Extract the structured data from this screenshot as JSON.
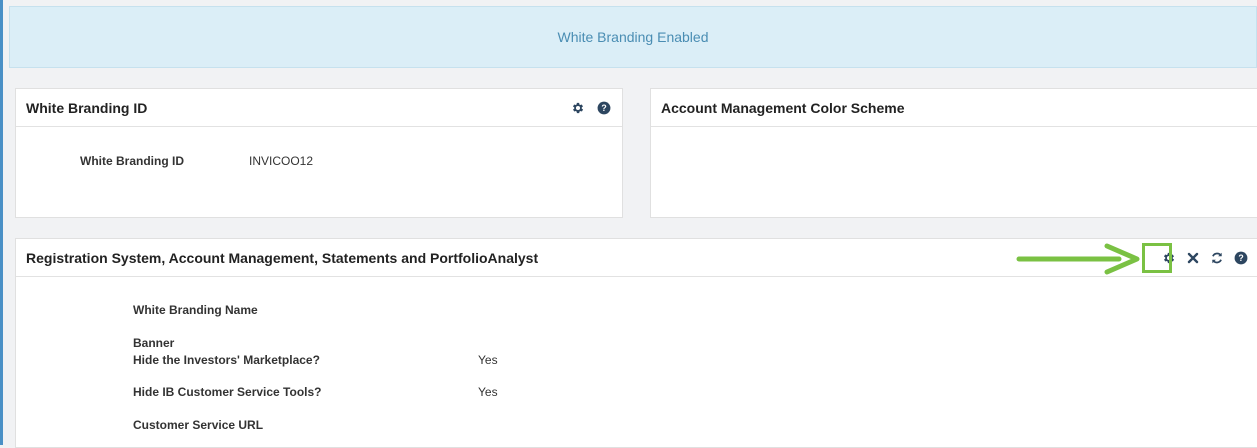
{
  "banner": {
    "text": "White Branding Enabled"
  },
  "wb_panel": {
    "title": "White Branding ID",
    "field_label": "White Branding ID",
    "field_value": "INVICOO12"
  },
  "color_panel": {
    "title": "Account Management Color Scheme"
  },
  "reg_panel": {
    "title": "Registration System, Account Management, Statements and PortfolioAnalyst",
    "rows": [
      {
        "label": "White Branding Name",
        "value": ""
      },
      {
        "label": "Banner",
        "value": ""
      },
      {
        "label": "Hide the Investors' Marketplace?",
        "value": "Yes"
      },
      {
        "label": "Hide IB Customer Service Tools?",
        "value": "Yes"
      },
      {
        "label": "Customer Service URL",
        "value": ""
      }
    ]
  },
  "icons": {
    "gear": "gear-icon",
    "help": "help-icon",
    "close": "close-icon",
    "refresh": "refresh-icon"
  },
  "colors": {
    "accent": "#4a90c6",
    "banner_bg": "#dbeef7",
    "highlight": "#7ac143",
    "icon": "#2d4660"
  }
}
